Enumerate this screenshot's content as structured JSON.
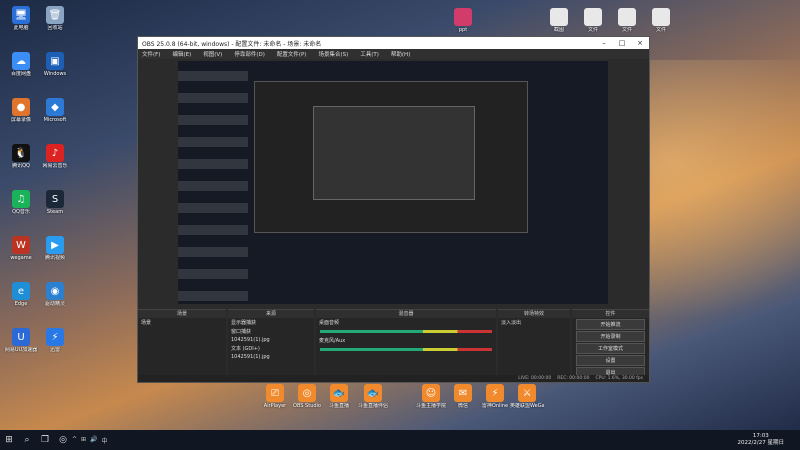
{
  "desktop": {
    "left_icons": [
      {
        "label": "此电脑",
        "glyph": "🖥",
        "color": "#2a6fd6"
      },
      {
        "label": "回收站",
        "glyph": "🗑",
        "color": "#8aa4c4"
      },
      {
        "label": "百度网盘",
        "glyph": "☁",
        "color": "#3a8ef6"
      },
      {
        "label": "Windows",
        "glyph": "▣",
        "color": "#1e5fb6"
      },
      {
        "label": "屏幕录像",
        "glyph": "●",
        "color": "#e0742a"
      },
      {
        "label": "Microsoft",
        "glyph": "◆",
        "color": "#2d7ad6"
      },
      {
        "label": "腾讯QQ",
        "glyph": "🐧",
        "color": "#111"
      },
      {
        "label": "网易云音乐",
        "glyph": "♪",
        "color": "#d22"
      },
      {
        "label": "QQ音乐",
        "glyph": "♫",
        "color": "#1bb35a"
      },
      {
        "label": "Steam",
        "glyph": "S",
        "color": "#1b2838"
      },
      {
        "label": "wegame",
        "glyph": "W",
        "color": "#b32"
      },
      {
        "label": "腾讯视频",
        "glyph": "▶",
        "color": "#2a9cf0"
      },
      {
        "label": "Edge",
        "glyph": "e",
        "color": "#1e8fd6"
      },
      {
        "label": "驱动精灵",
        "glyph": "◉",
        "color": "#2b80d0"
      },
      {
        "label": "网易UU加速器",
        "glyph": "U",
        "color": "#2b6ad6"
      },
      {
        "label": "迅雷",
        "glyph": "⚡",
        "color": "#2878e6"
      }
    ],
    "top_right_icons": [
      "ppt",
      "截图",
      "文件",
      "文件",
      "文件"
    ],
    "taskbar_apps": [
      {
        "label": "AirPlayer",
        "glyph": "⎚"
      },
      {
        "label": "OBS Studio",
        "glyph": "◎"
      },
      {
        "label": "斗鱼直播",
        "glyph": "🐟"
      },
      {
        "label": "斗鱼直播伴侣",
        "glyph": "🐟"
      },
      {
        "label": "斗鱼主播学院",
        "glyph": "☺"
      },
      {
        "label": "微信",
        "glyph": "✉"
      },
      {
        "label": "雷神Online",
        "glyph": "⚡"
      },
      {
        "label": "英雄联盟WeGame版",
        "glyph": "⚔"
      }
    ]
  },
  "obs": {
    "title": "OBS 25.0.8 (64-bit, windows) - 配置文件: 未命名 - 场景: 未命名",
    "menu": [
      "文件(F)",
      "编辑(E)",
      "视图(V)",
      "停靠部件(D)",
      "配置文件(P)",
      "场景集合(S)",
      "工具(T)",
      "帮助(H)"
    ],
    "docks": {
      "scenes": {
        "header": "场景",
        "items": [
          "场景"
        ]
      },
      "sources": {
        "header": "来源",
        "items": [
          "显示器捕获",
          "窗口捕获",
          "1042591(1).jpg",
          "文本 (GDI+)",
          "1042591(1).jpg"
        ]
      },
      "mixer": {
        "header": "混音器",
        "items": [
          "桌面音频",
          "麦克风/Aux"
        ]
      },
      "transitions": {
        "header": "转场特效",
        "items": [
          "淡入淡出"
        ]
      },
      "controls": {
        "header": "控件",
        "buttons": [
          "开始推流",
          "开始录制",
          "工作室模式",
          "设置",
          "退出"
        ]
      }
    },
    "status": [
      "LIVE: 00:00:00",
      "REC: 00:00:00",
      "CPU: 1.6%, 30.00 fps"
    ]
  },
  "taskbar": {
    "time": "17:03",
    "date": "2022/2/27 星期日",
    "tray": [
      "^",
      "⊞",
      "🔊",
      "中"
    ]
  }
}
